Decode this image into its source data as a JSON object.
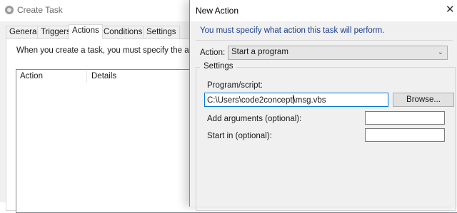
{
  "create_task": {
    "title": "Create Task",
    "tabs": [
      {
        "label": "General"
      },
      {
        "label": "Triggers"
      },
      {
        "label": "Actions"
      },
      {
        "label": "Conditions"
      },
      {
        "label": "Settings"
      }
    ],
    "active_tab": "Actions",
    "description": "When you create a task, you must specify the action tha",
    "list_columns": [
      "Action",
      "Details"
    ]
  },
  "new_action": {
    "title": "New Action",
    "close_glyph": "✕",
    "message": "You must specify what action this task will perform.",
    "action_label": "Action:",
    "action_value": "Start a program",
    "settings_legend": "Settings",
    "program_label": "Program/script:",
    "program_value_before_caret": "C:\\Users\\code2concept",
    "program_value_after_caret": "\\msg.vbs",
    "browse_label": "Browse...",
    "arguments_label": "Add arguments (optional):",
    "arguments_value": "",
    "start_in_label": "Start in (optional):",
    "start_in_value": ""
  },
  "colors": {
    "info_text": "#1a3d8f",
    "focus_border": "#0078d7",
    "window_bg": "#f0f0f0"
  }
}
